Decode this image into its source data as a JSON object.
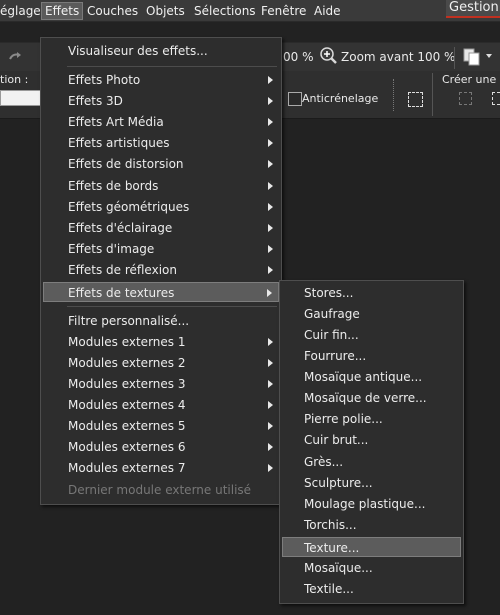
{
  "app": {
    "title": "Gestion"
  },
  "menubar": {
    "items": [
      "églage",
      "Effets",
      "Couches",
      "Objets",
      "Sélections",
      "Fenêtre",
      "Aide"
    ]
  },
  "toolbar": {
    "zoom_percent": "00 %",
    "zoom_in_label": "Zoom avant 100 %",
    "section_label": "tion :",
    "antialias_label": "Anticrénelage",
    "create_label": "Créer une se"
  },
  "effects_menu": {
    "items": [
      {
        "label": "Visualiseur des effets...",
        "submenu": false
      },
      {
        "label": "Effets Photo",
        "submenu": true
      },
      {
        "label": "Effets 3D",
        "submenu": true
      },
      {
        "label": "Effets Art Média",
        "submenu": true
      },
      {
        "label": "Effets artistiques",
        "submenu": true
      },
      {
        "label": "Effets de distorsion",
        "submenu": true
      },
      {
        "label": "Effets de bords",
        "submenu": true
      },
      {
        "label": "Effets géométriques",
        "submenu": true
      },
      {
        "label": "Effets d'éclairage",
        "submenu": true
      },
      {
        "label": "Effets d'image",
        "submenu": true
      },
      {
        "label": "Effets de réflexion",
        "submenu": true
      },
      {
        "label": "Effets de textures",
        "submenu": true,
        "highlighted": true
      },
      {
        "label": "Filtre personnalisé...",
        "submenu": false
      },
      {
        "label": "Modules externes 1",
        "submenu": true
      },
      {
        "label": "Modules externes 2",
        "submenu": true
      },
      {
        "label": "Modules externes 3",
        "submenu": true
      },
      {
        "label": "Modules externes 4",
        "submenu": true
      },
      {
        "label": "Modules externes 5",
        "submenu": true
      },
      {
        "label": "Modules externes 6",
        "submenu": true
      },
      {
        "label": "Modules externes 7",
        "submenu": true
      },
      {
        "label": "Dernier module externe utilisé",
        "submenu": false,
        "disabled": true
      }
    ]
  },
  "textures_submenu": {
    "items": [
      "Stores...",
      "Gaufrage",
      "Cuir fin...",
      "Fourrure...",
      "Mosaïque antique...",
      "Mosaïque de verre...",
      "Pierre polie...",
      "Cuir brut...",
      "Grès...",
      "Sculpture...",
      "Moulage plastique...",
      "Torchis...",
      "Texture...",
      "Mosaïque...",
      "Textile..."
    ],
    "highlighted": "Texture..."
  },
  "colors": {
    "accent": "#c03020",
    "menu_bg": "#2d2d2d",
    "highlight": "#5c5c5c"
  }
}
